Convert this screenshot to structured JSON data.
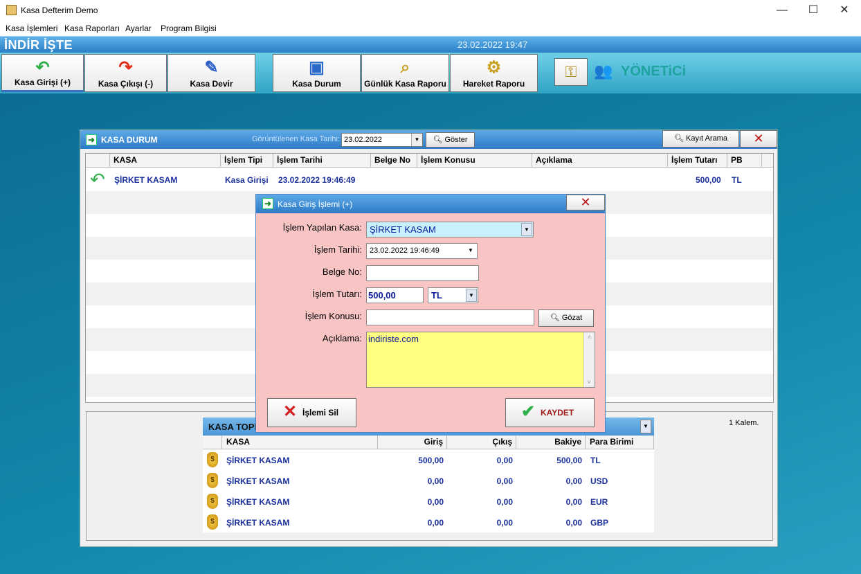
{
  "window": {
    "title": "Kasa Defterim Demo",
    "min": "—",
    "max": "☐",
    "close": "✕"
  },
  "menu": [
    "Kasa İşlemleri",
    "Kasa Raporları",
    "Ayarlar",
    "Program Bilgisi"
  ],
  "band": {
    "brand": "İNDİR İŞTE",
    "datetime": "23.02.2022 19:47"
  },
  "toolbar": {
    "items": [
      {
        "label": "Kasa Girişi  (+)",
        "icon": "green-undo-arrow-icon"
      },
      {
        "label": "Kasa Çıkışı (-)",
        "icon": "red-redo-arrow-icon"
      },
      {
        "label": "Kasa Devir",
        "icon": "clipboard-pen-icon"
      },
      {
        "label": "Kasa Durum",
        "icon": "computer-terminal-icon"
      },
      {
        "label": "Günlük Kasa Raporu",
        "icon": "magnifier-document-icon"
      },
      {
        "label": "Hareket Raporu",
        "icon": "gear-document-icon"
      }
    ],
    "user": "YÖNETiCi"
  },
  "kasa_durum": {
    "title": "KASA DURUM",
    "date_label": "Görüntülenen Kasa Tarihi:",
    "date_value": "23.02.2022",
    "show_button": "Göster",
    "search_button": "Kayıt Arama",
    "columns": [
      "KASA",
      "İşlem Tipi",
      "İşlem Tarihi",
      "Belge No",
      "İşlem Konusu",
      "Açıklama",
      "İşlem Tutarı",
      "PB"
    ],
    "rows": [
      {
        "kasa": "ŞİRKET KASAM",
        "tip": "Kasa Girişi",
        "tarih": "23.02.2022 19:46:49",
        "belge": "",
        "konu": "",
        "aciklama": "",
        "tutar": "500,00",
        "pb": "TL"
      }
    ]
  },
  "totals": {
    "title": "KASA TOPI",
    "count": "1 Kalem.",
    "columns": [
      "KASA",
      "Giriş",
      "Çıkış",
      "Bakiye",
      "Para Birimi"
    ],
    "rows": [
      {
        "kasa": "ŞİRKET KASAM",
        "giris": "500,00",
        "cikis": "0,00",
        "bakiye": "500,00",
        "pb": "TL"
      },
      {
        "kasa": "ŞİRKET KASAM",
        "giris": "0,00",
        "cikis": "0,00",
        "bakiye": "0,00",
        "pb": "USD"
      },
      {
        "kasa": "ŞİRKET KASAM",
        "giris": "0,00",
        "cikis": "0,00",
        "bakiye": "0,00",
        "pb": "EUR"
      },
      {
        "kasa": "ŞİRKET KASAM",
        "giris": "0,00",
        "cikis": "0,00",
        "bakiye": "0,00",
        "pb": "GBP"
      }
    ]
  },
  "dialog": {
    "title": "Kasa Giriş İşlemi (+)",
    "kasa_label": "İşlem Yapılan Kasa:",
    "kasa_value": "ŞİRKET KASAM",
    "tarih_label": "İşlem Tarihi:",
    "tarih_value": "23.02.2022 19:46:49",
    "belge_label": "Belge No:",
    "belge_value": "",
    "tutar_label": "İşlem Tutarı:",
    "tutar_value": "500,00",
    "pb_value": "TL",
    "konu_label": "İşlem Konusu:",
    "konu_value": "",
    "gozat_button": "Gözat",
    "aciklama_label": "Açıklama:",
    "aciklama_value": "indiriste.com",
    "delete_button": "İşlemi Sil",
    "save_button": "KAYDET"
  }
}
